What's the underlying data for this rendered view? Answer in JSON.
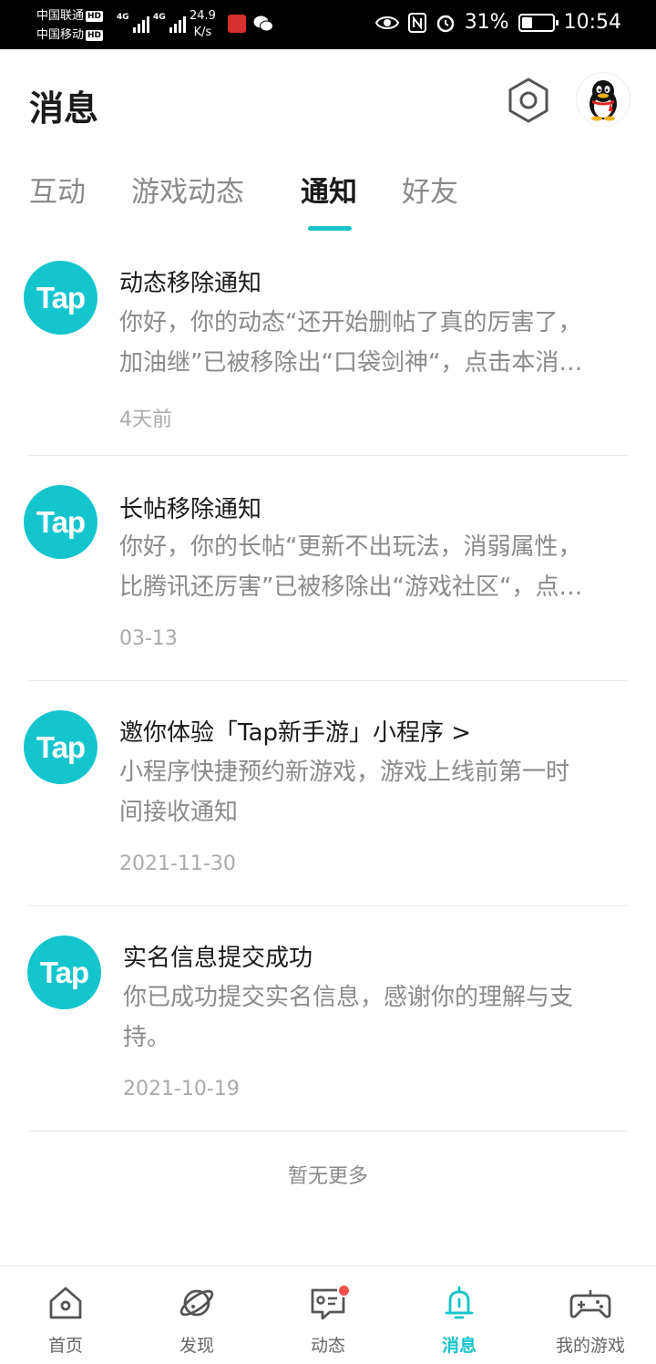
{
  "status_bar": {
    "carrier1": "中国联通",
    "carrier2": "中国移动",
    "hd_badge": "HD",
    "network": "4G",
    "speed_value": "24.9",
    "speed_unit": "K/s",
    "battery": "31%",
    "time": "10:54",
    "icons": [
      "eye-icon",
      "nfc-icon",
      "alarm-icon",
      "battery-icon"
    ]
  },
  "header": {
    "title": "消息",
    "settings_icon": "hexagon-settings-icon",
    "avatar_icon": "qq-penguin-icon"
  },
  "tabs": [
    {
      "label": "互动",
      "active": false
    },
    {
      "label": "游戏动态",
      "active": false
    },
    {
      "label": "通知",
      "active": true
    },
    {
      "label": "好友",
      "active": false
    }
  ],
  "notifications": [
    {
      "logo": "Tap",
      "title": "动态移除通知",
      "body_lines": [
        "你好，你的动态“还开始删帖了真的厉害了，",
        "加油继”已被移除出“口袋剑神“，点击本消…"
      ],
      "time": "4天前"
    },
    {
      "logo": "Tap",
      "title": "长帖移除通知",
      "body_lines": [
        "你好，你的长帖“更新不出玩法，消弱属性，",
        "比腾讯还厉害”已被移除出“游戏社区“，点…"
      ],
      "time": "03-13"
    },
    {
      "logo": "Tap",
      "title": "邀你体验「Tap新手游」小程序 >",
      "body_lines": [
        "小程序快捷预约新游戏，游戏上线前第一时",
        "间接收通知"
      ],
      "time": "2021-11-30"
    },
    {
      "logo": "Tap",
      "title": "实名信息提交成功",
      "body_lines": [
        "你已成功提交实名信息，感谢你的理解与支",
        "持。"
      ],
      "time": "2021-10-19"
    }
  ],
  "footer_text": "暂无更多",
  "bottom_nav": [
    {
      "label": "首页",
      "icon": "home-icon",
      "active": false
    },
    {
      "label": "发现",
      "icon": "planet-icon",
      "active": false
    },
    {
      "label": "动态",
      "icon": "chat-card-icon",
      "active": false,
      "badge": true
    },
    {
      "label": "消息",
      "icon": "bell-icon",
      "active": true
    },
    {
      "label": "我的游戏",
      "icon": "gamepad-icon",
      "active": false
    }
  ],
  "colors": {
    "accent": "#14c4c9",
    "tap_logo": "#15c5ce",
    "badge_red": "#f2504b"
  }
}
